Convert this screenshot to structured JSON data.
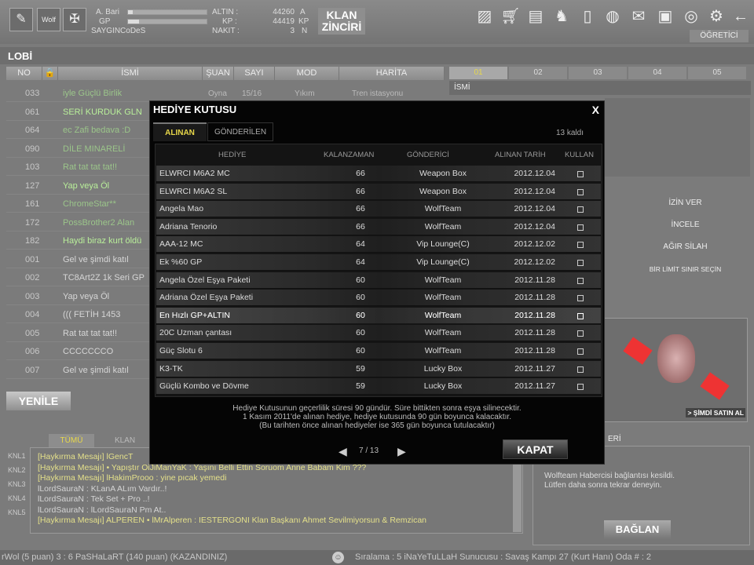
{
  "top": {
    "exp_label": "A. Bari",
    "gp_label": "GP",
    "sayginlik": "SAYGINCoDeS",
    "exp_fill": 0.06,
    "gp_fill": 0.14,
    "altin_label": "ALTIN :",
    "kp_label": "KP :",
    "nakit_label": "NAKIT :",
    "altin": "44260",
    "kp": "44419",
    "nakit": "3",
    "altin_unit": "A",
    "kp_unit": "KP",
    "nakit_unit": "N",
    "klan_line1": "KLAN",
    "klan_line2": "ZİNCİRİ",
    "ogretici": "ÖĞRETİCİ",
    "icons": [
      "chat-icon",
      "cart-icon",
      "inventory-icon",
      "wolf-icon",
      "book-icon",
      "backpack-icon",
      "mail-icon",
      "folder-user-icon",
      "globe-search-icon",
      "gear-icon",
      "back-arrow-icon"
    ]
  },
  "lobby": {
    "title": "LOBİ",
    "columns": [
      "NO",
      "🔒",
      "İSMİ",
      "ŞUAN",
      "SAYI",
      "MOD",
      "HARİTA"
    ],
    "first_row": {
      "state": "Oyna",
      "count": "15/16",
      "mode": "Yıkım",
      "map": "Tren istasyonu"
    },
    "rows": [
      {
        "no": "033",
        "name": "iyle Güçlü Birlik"
      },
      {
        "no": "061",
        "name": "SERİ KURDUK GLN"
      },
      {
        "no": "064",
        "name": "ec Zafi bedava :D"
      },
      {
        "no": "090",
        "name": "DİLE MINARELİ"
      },
      {
        "no": "103",
        "name": "Rat tat tat tat!!"
      },
      {
        "no": "127",
        "name": "Yap veya Öl"
      },
      {
        "no": "161",
        "name": "ChromeStar**"
      },
      {
        "no": "172",
        "name": "PossBrother2 Alan"
      },
      {
        "no": "182",
        "name": "Haydi biraz kurt öldü"
      },
      {
        "no": "001",
        "name": "Gel ve şimdi katıl"
      },
      {
        "no": "002",
        "name": "TC8Art2Z 1k Seri GP"
      },
      {
        "no": "003",
        "name": "Yap veya Öl"
      },
      {
        "no": "004",
        "name": "    ((( FETİH 1453"
      },
      {
        "no": "005",
        "name": "Rat tat tat tat!!"
      },
      {
        "no": "006",
        "name": "CCCCCCCO"
      },
      {
        "no": "007",
        "name": "Gel ve şimdi katıl"
      }
    ],
    "refresh": "YENİLE"
  },
  "right": {
    "tabs": [
      "01",
      "02",
      "03",
      "04",
      "05"
    ],
    "name_label": "İSMİ",
    "buttons": [
      "İZİN VER",
      "İNCELE",
      "AĞIR SİLAH",
      "BİR LİMİT SINIR SEÇİN"
    ],
    "buy_now": "> ŞİMDİ SATIN AL",
    "msg_header": "ERİ",
    "msg": "Wolfteam Habercisi bağlantısı kesildi. Lütfen daha sonra tekrar deneyin.",
    "connect": "BAĞLAN"
  },
  "chat": {
    "tabs": [
      "TÜMÜ",
      "KLAN"
    ],
    "channels": [
      "KNL1",
      "KNL2",
      "KNL3",
      "KNL4",
      "KNL5"
    ],
    "lines": [
      {
        "t": "[Haykırma Mesajı]  lGencT",
        "y": true
      },
      {
        "t": "[Haykırma Mesajı]  • Yapıştır  OiJiManYaK : Yaşını Belli Ettin Soruom Anne Babam Kim ???",
        "y": true
      },
      {
        "t": "[Haykırma Mesajı]  lHakimProoo : yine pıcak yemedi",
        "y": true
      },
      {
        "t": "lLordSauraN : KLanA ALım Vardır..!",
        "y": false
      },
      {
        "t": "lLordSauraN : Tek Set + Pro ..!",
        "y": false
      },
      {
        "t": "lLordSauraN : lLordSauraN Pm At..",
        "y": false
      },
      {
        "t": "[Haykırma Mesajı]  ALPEREN •  lMrAlperen : IESTERGONI Klan Başkanı Ahmet Sevilmiyorsun & Remzican",
        "y": true
      }
    ]
  },
  "status": {
    "left": "rWol (5 puan) 3 : 6 PaSHaLaRT (140 puan) (KAZANDINIZ)",
    "right": "Sıralama : 5 iNaYeTuLLaH Sunucusu : Savaş Kampı 27 (Kurt Hanı) Oda # : 2"
  },
  "dialog": {
    "title": "HEDİYE KUTUSU",
    "close": "X",
    "tabs": [
      "ALINAN",
      "GÖNDERİLEN"
    ],
    "remaining": "13 kaldı",
    "columns": [
      "HEDİYE",
      "KALANZAMAN",
      "GÖNDERİCİ",
      "ALINAN TARİH",
      "KULLAN"
    ],
    "rows": [
      [
        "ELWRCI M6A2 MC",
        "66",
        "Weapon Box",
        "2012.12.04"
      ],
      [
        "ELWRCI M6A2 SL",
        "66",
        "Weapon Box",
        "2012.12.04"
      ],
      [
        "Angela Mao",
        "66",
        "WolfTeam",
        "2012.12.04"
      ],
      [
        "Adriana Tenorio",
        "66",
        "WolfTeam",
        "2012.12.04"
      ],
      [
        "AAA-12 MC",
        "64",
        "Vip Lounge(C)",
        "2012.12.02"
      ],
      [
        "Ek %60 GP",
        "64",
        "Vip Lounge(C)",
        "2012.12.02"
      ],
      [
        "Angela Özel Eşya Paketi",
        "60",
        "WolfTeam",
        "2012.11.28"
      ],
      [
        "Adriana Özel Eşya Paketi",
        "60",
        "WolfTeam",
        "2012.11.28"
      ],
      [
        "En Hızlı GP+ALTIN",
        "60",
        "WolfTeam",
        "2012.11.28"
      ],
      [
        "20C Uzman çantası",
        "60",
        "WolfTeam",
        "2012.11.28"
      ],
      [
        "Güç Slotu 6",
        "60",
        "WolfTeam",
        "2012.11.28"
      ],
      [
        "K3-TK",
        "59",
        "Lucky Box",
        "2012.11.27"
      ],
      [
        "Güçlü Kombo ve Dövme",
        "59",
        "Lucky Box",
        "2012.11.27"
      ]
    ],
    "note": [
      "Hediye Kutusunun geçerlilik süresi 90 gündür. Süre bittikten sonra eşya silinecektir.",
      "1 Kasım 2011'de alınan hediye, hediye kutusunda 90 gün boyunca kalacaktır.",
      "(Bu tarihten önce alınan hediyeler ise 365 gün boyunca tutulacaktır)"
    ],
    "page": "7 / 13",
    "close_button": "KAPAT"
  },
  "colors": {
    "accent_yellow": "#e8d84a",
    "green_text": "#a6d98a",
    "chat_yellow": "#e4e08a"
  }
}
